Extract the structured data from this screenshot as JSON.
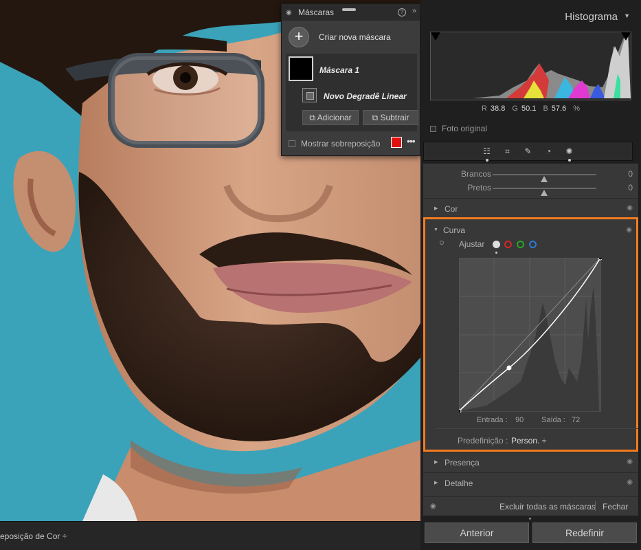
{
  "bottom_bar": {
    "overlay_mode": "eposição de Cor ÷"
  },
  "masks_panel": {
    "title": "Máscaras",
    "help": "?",
    "collapse": "»",
    "create_label": "Criar nova máscara",
    "plus": "+",
    "mask_name": "Máscara 1",
    "sub_name": "Novo Degradê Linear",
    "add_label": "Adicionar",
    "subtract_label": "Subtrair",
    "show_overlay_label": "Mostrar sobreposição",
    "overlay_color": "#e01010",
    "more": "•••"
  },
  "histogram": {
    "title": "Histograma",
    "caret": "▼",
    "r_label": "R",
    "r_value": "38.8",
    "g_label": "G",
    "g_value": "50.1",
    "b_label": "B",
    "b_value": "57.6",
    "unit": "%",
    "original_label": "Foto original"
  },
  "tools": [
    "sliders-icon",
    "crop-icon",
    "heal-icon",
    "redeye-icon",
    "mask-icon"
  ],
  "sliders": [
    {
      "label": "Brancos",
      "value": "0",
      "level": 0.5
    },
    {
      "label": "Pretos",
      "value": "0",
      "level": 0.5
    }
  ],
  "sections": {
    "cor": "Cor",
    "curva": "Curva",
    "presenca": "Presença",
    "detalhe": "Detalhe"
  },
  "curve": {
    "adjust_label": "Ajustar",
    "input_label": "Entrada :",
    "input_value": "90",
    "output_label": "Saída :",
    "output_value": "72",
    "preset_label": "Predefinição :",
    "preset_value": "Person. ÷"
  },
  "footer": {
    "clear_all": "Excluir todas as máscaras",
    "close": "Fechar",
    "previous": "Anterior",
    "reset": "Redefinir"
  }
}
